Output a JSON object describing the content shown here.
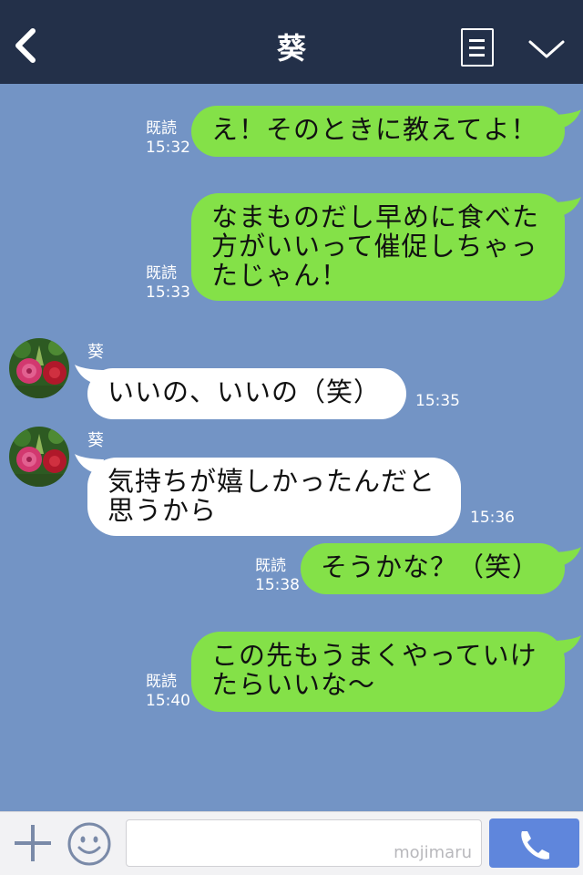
{
  "header": {
    "title": "葵",
    "back_icon": "chevron-left-icon",
    "menu_icon": "menu-list-icon",
    "collapse_icon": "chevron-down-icon"
  },
  "colors": {
    "header_bg": "#233049",
    "chat_bg": "#7394c5",
    "outgoing_bubble": "#84e148",
    "incoming_bubble": "#ffffff",
    "call_button": "#5f86dc"
  },
  "messages": [
    {
      "direction": "out",
      "lines": [
        "え！そのときに教えてよ！"
      ],
      "read_label": "既読",
      "time": "15:32"
    },
    {
      "direction": "out",
      "lines": [
        "なまものだし早めに食べた",
        "方がいいって催促しちゃっ",
        "たじゃん！"
      ],
      "read_label": "既読",
      "time": "15:33"
    },
    {
      "direction": "in",
      "sender": "葵",
      "lines": [
        "いいの、いいの（笑）"
      ],
      "time": "15:35"
    },
    {
      "direction": "in",
      "sender": "葵",
      "lines": [
        "気持ちが嬉しかったんだと",
        "思うから"
      ],
      "time": "15:36"
    },
    {
      "direction": "out",
      "lines": [
        "そうかな？（笑）"
      ],
      "read_label": "既読",
      "time": "15:38"
    },
    {
      "direction": "out",
      "lines": [
        "この先もうまくやっていけ",
        "たらいいな〜"
      ],
      "read_label": "既読",
      "time": "15:40"
    }
  ],
  "footer": {
    "plus_icon": "plus-icon",
    "emoji_icon": "smiley-icon",
    "input_value": "",
    "watermark": "mojimaru",
    "call_icon": "phone-icon"
  }
}
